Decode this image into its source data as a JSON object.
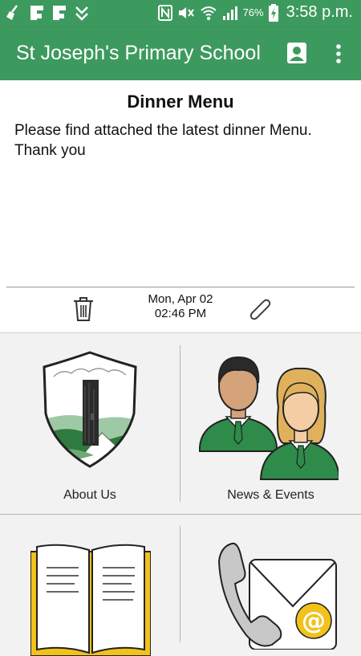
{
  "status_bar": {
    "battery": "76%",
    "time": "3:58 p.m."
  },
  "app_bar": {
    "title": "St Joseph's Primary School",
    "icons": [
      "contact-card-icon",
      "more-vert-icon"
    ]
  },
  "message": {
    "title": "Dinner Menu",
    "body": "Please find attached the latest dinner Menu.\nThank you",
    "date": "Mon, Apr 02",
    "time": "02:46 PM",
    "icons": [
      "trash-icon",
      "paperclip-icon"
    ]
  },
  "tiles": [
    {
      "label": "About Us",
      "icon": "school-crest-icon"
    },
    {
      "label": "News & Events",
      "icon": "students-icon"
    },
    {
      "label": "",
      "icon": "open-book-icon"
    },
    {
      "label": "",
      "icon": "phone-mail-icon"
    }
  ],
  "colors": {
    "primary": "#3d9a5e",
    "tile_background": "#f2f2f2",
    "uniform_green": "#2e8b4a",
    "book_yellow": "#f2c21b"
  }
}
